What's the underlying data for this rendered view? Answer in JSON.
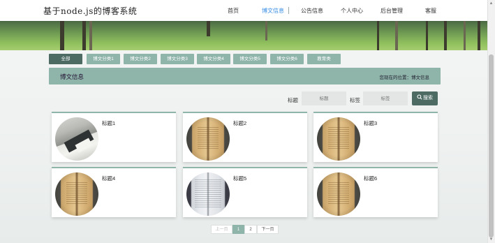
{
  "header": {
    "brand": "基于node.js的博客系统",
    "nav": [
      {
        "label": "首页"
      },
      {
        "label": "博文信息"
      },
      {
        "label": "公告信息"
      },
      {
        "label": "个人中心"
      },
      {
        "label": "后台管理"
      },
      {
        "label": "客服"
      }
    ],
    "active_nav": "博文信息"
  },
  "categories": {
    "items": [
      "全部",
      "博文分类1",
      "博文分类2",
      "博文分类3",
      "博文分类4",
      "博文分类5",
      "博文分类6",
      "教育类"
    ],
    "active": "全部"
  },
  "section": {
    "title": "博文信息",
    "location": "您现在的位置：博文信息"
  },
  "search": {
    "title_label": "标题",
    "title_placeholder": "标题",
    "tag_label": "标签",
    "tag_placeholder": "标签",
    "button_label": "搜索"
  },
  "posts": [
    {
      "title": "标题1",
      "image": "library-photo"
    },
    {
      "title": "标题2",
      "image": "open-book-photo"
    },
    {
      "title": "标题3",
      "image": "open-book-photo"
    },
    {
      "title": "标题4",
      "image": "open-book-photo"
    },
    {
      "title": "标题5",
      "image": "white-book-photo"
    },
    {
      "title": "标题6",
      "image": "open-book-photo"
    }
  ],
  "pagination": {
    "prev": "上一页",
    "pages": [
      "1",
      "2"
    ],
    "current": "1",
    "next": "下一页"
  },
  "colors": {
    "accent": "#8fb4a9",
    "accent_dark": "#4d6b63",
    "nav_active": "#3a8ee6"
  }
}
